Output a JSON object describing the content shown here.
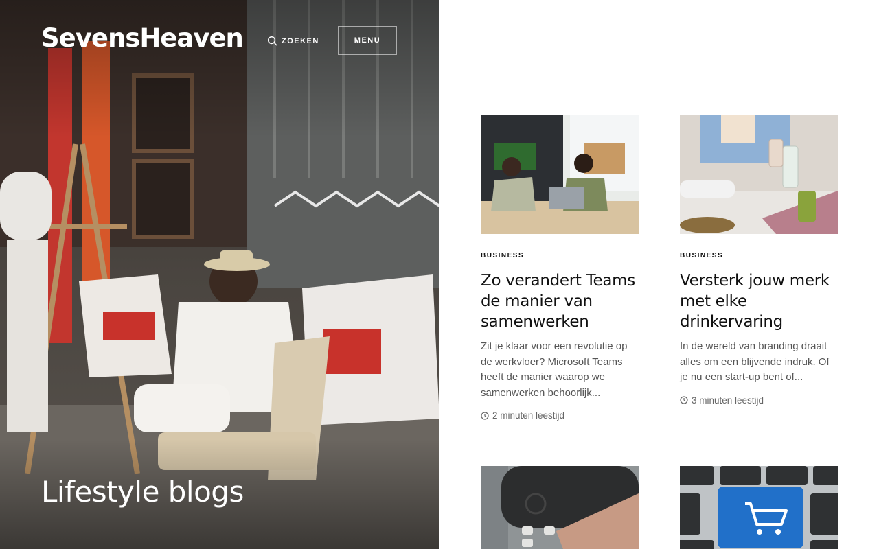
{
  "site": {
    "title": "SevensHeaven"
  },
  "header": {
    "search_label": "ZOEKEN",
    "menu_label": "MENU"
  },
  "hero": {
    "heading": "Lifestyle blogs"
  },
  "posts": [
    {
      "category": "BUSINESS",
      "title": "Zo verandert Teams de manier van samenwerken",
      "excerpt": "Zit je klaar voor een revolutie op de werkvloer? Microsoft Teams heeft de manier waarop we samenwerken behoorlijk...",
      "reading_time": "2 minuten leestijd"
    },
    {
      "category": "BUSINESS",
      "title": "Versterk jouw merk met elke drinkervaring",
      "excerpt": "In de wereld van branding draait alles om een blijvende indruk. Of je nu een start-up bent of...",
      "reading_time": "3 minuten leestijd"
    }
  ]
}
